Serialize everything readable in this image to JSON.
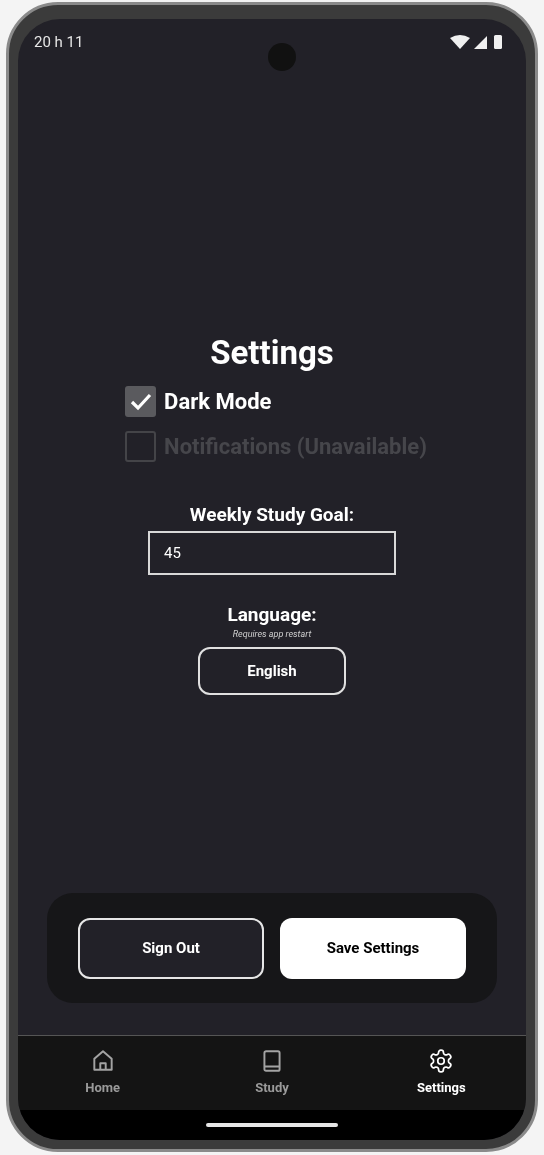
{
  "status_bar": {
    "time": "20 h 11"
  },
  "title": "Settings",
  "options": [
    {
      "label": "Dark Mode",
      "checked": true,
      "disabled": false
    },
    {
      "label": "Notifications (Unavailable)",
      "checked": false,
      "disabled": true
    }
  ],
  "weekly_goal": {
    "label": "Weekly Study Goal:",
    "value": "45"
  },
  "language": {
    "label": "Language:",
    "hint": "Requires app restart",
    "button": "English"
  },
  "actions": [
    {
      "label": "Sign Out",
      "kind": "outline"
    },
    {
      "label": "Save Settings",
      "kind": "filled"
    }
  ],
  "nav": [
    {
      "label": "Home",
      "selected": false
    },
    {
      "label": "Study",
      "selected": false
    },
    {
      "label": "Settings",
      "selected": true
    }
  ]
}
